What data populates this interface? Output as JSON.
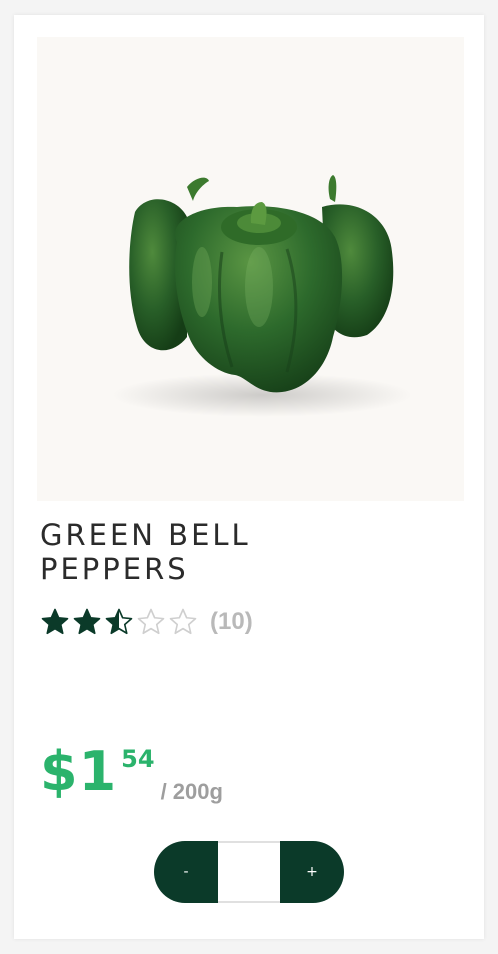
{
  "product": {
    "title_line1": "GREEN BELL",
    "title_line2": "PEPPERS",
    "rating": 2.5,
    "rating_max": 5,
    "reviews": "(10)",
    "price_whole": "$1",
    "price_cents": "54",
    "unit": "/ 200g",
    "image_icon": "green-bell-peppers-photo"
  },
  "stepper": {
    "minus_label": "-",
    "plus_label": "+",
    "quantity": ""
  },
  "colors": {
    "accent_green": "#2bb36c",
    "dark_green": "#0b3a29",
    "star_filled": "#0b3a29",
    "star_empty": "#cfcfcf"
  }
}
